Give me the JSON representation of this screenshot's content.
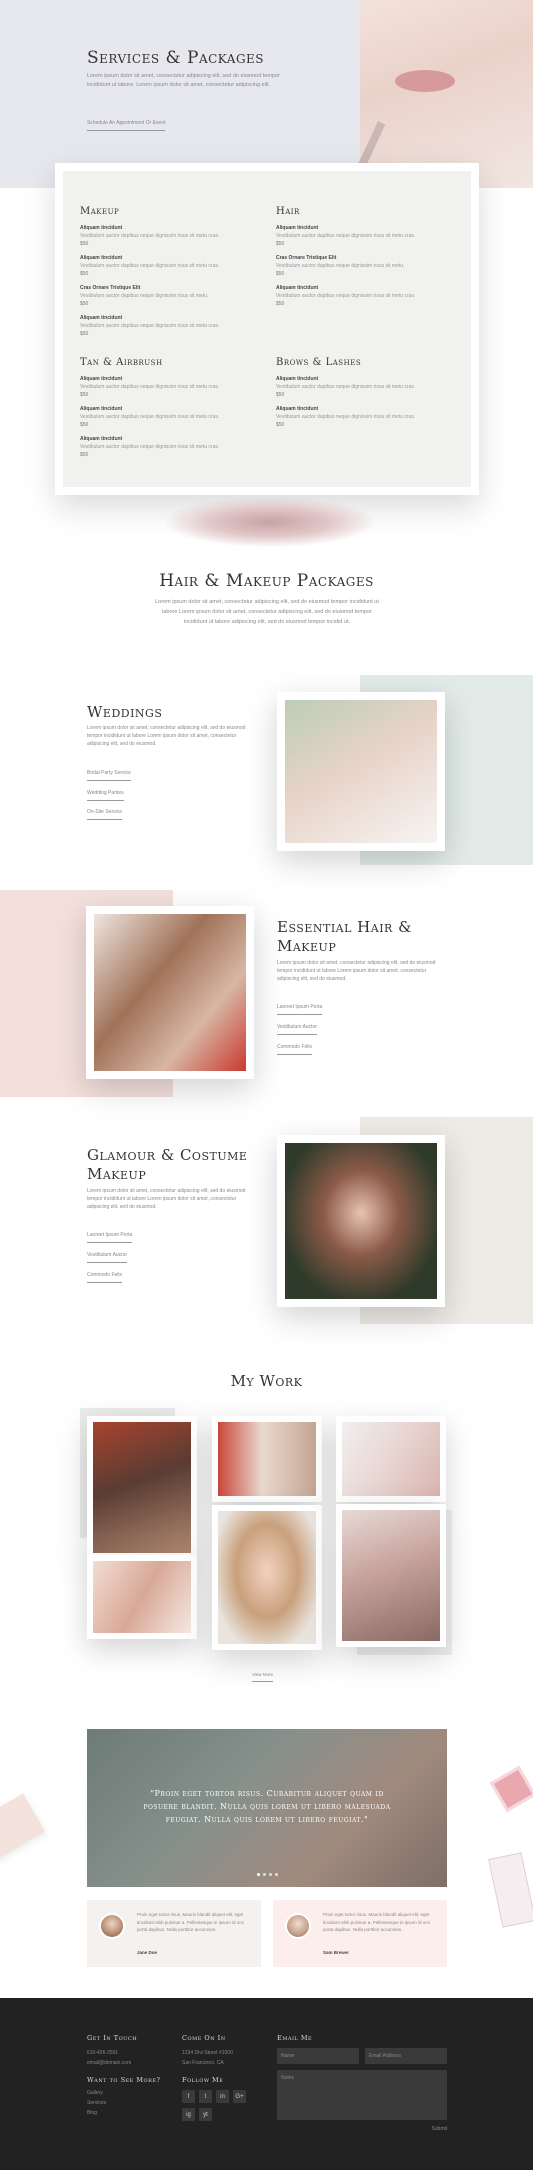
{
  "hero": {
    "title": "Services & Packages",
    "body": "Lorem ipsum dolor sit amet, consectetur adipiscing elit, sed do eiusmod tempor incididunt ut labore. Lorem ipsum dolor sit amet, consectetur adipiscing elit.",
    "cta": "Schedule An Appointment Or Event"
  },
  "services": {
    "makeup": {
      "heading": "Makeup",
      "items": [
        {
          "name": "Aliquam tincidunt",
          "desc": "Vestibulum auctor dapibus neque dignissim risus sit metu cras.",
          "price": "$50"
        },
        {
          "name": "Aliquam tincidunt",
          "desc": "Vestibulum auctor dapibus neque dignissim risus sit metu cras.",
          "price": "$50"
        },
        {
          "name": "Cras Ornare Tristique Elit",
          "desc": "Vestibulum auctor dapibus neque dignissim risus sit metu.",
          "price": "$50"
        },
        {
          "name": "Aliquam tincidunt",
          "desc": "Vestibulum auctor dapibus neque dignissim risus sit metu cras.",
          "price": "$50"
        }
      ]
    },
    "hair": {
      "heading": "Hair",
      "items": [
        {
          "name": "Aliquam tincidunt",
          "desc": "Vestibulum auctor dapibus neque dignissim risus sit metu cras.",
          "price": "$50"
        },
        {
          "name": "Cras Ornare Tristique Elit",
          "desc": "Vestibulum auctor dapibus neque dignissim risus sit metu.",
          "price": "$50"
        },
        {
          "name": "Aliquam tincidunt",
          "desc": "Vestibulum auctor dapibus neque dignissim risus sit metu cras.",
          "price": "$50"
        }
      ]
    },
    "tan": {
      "heading": "Tan & Airbrush",
      "items": [
        {
          "name": "Aliquam tincidunt",
          "desc": "Vestibulum auctor dapibus neque dignissim risus sit metu cras.",
          "price": "$50"
        },
        {
          "name": "Aliquam tincidunt",
          "desc": "Vestibulum auctor dapibus neque dignissim risus sit metu cras.",
          "price": "$50"
        },
        {
          "name": "Aliquam tincidunt",
          "desc": "Vestibulum auctor dapibus neque dignissim risus sit metu cras.",
          "price": "$50"
        }
      ]
    },
    "brows": {
      "heading": "Brows & Lashes",
      "items": [
        {
          "name": "Aliquam tincidunt",
          "desc": "Vestibulum auctor dapibus neque dignissim risus sit metu cras.",
          "price": "$50"
        },
        {
          "name": "Aliquam tincidunt",
          "desc": "Vestibulum auctor dapibus neque dignissim risus sit metu cras.",
          "price": "$50"
        }
      ]
    }
  },
  "packages": {
    "title": "Hair & Makeup Packages",
    "body": "Lorem ipsum dolor sit amet, consectetur adipiscing elit, sed do eiusmod tempor incididunt ut labore Lorem ipsum dolor sit amet, consectetur adipiscing elit, sed do eiusmod tempor incididunt ut labore adipiscing elit, sed do eiusmod tempor incidid ut."
  },
  "weddings": {
    "title": "Weddings",
    "body": "Lorem ipsum dolor sit amet, consectetur adipiscing elit, sed do eiusmod tempor incididunt ut labore Lorem ipsum dolor sit amet, consectetur adipiscing elit, sed do eiusmod.",
    "links": [
      "Bridal Party Service",
      "Wedding Parties",
      "On-Site Service"
    ]
  },
  "essential": {
    "title": "Essential Hair & Makeup",
    "body": "Lorem ipsum dolor sit amet, consectetur adipiscing elit, sed do eiusmod tempor incididunt ut labore Lorem ipsum dolor sit amet, consectetur adipiscing elit, sed do eiusmod.",
    "links": [
      "Laoreet Ipsum Porta",
      "Vestibulum Auctor",
      "Commodo Felis"
    ]
  },
  "glamour": {
    "title": "Glamour & Costume Makeup",
    "body": "Lorem ipsum dolor sit amet, consectetur adipiscing elit, sed do eiusmod tempor incididunt ut labore Lorem ipsum dolor sit amet, consectetur adipiscing elit, sed do eiusmod.",
    "links": [
      "Laoreet Ipsum Porta",
      "Vestibulum Auctor",
      "Commodo Felis"
    ]
  },
  "work": {
    "title": "My Work",
    "button": "View More"
  },
  "testimonial": {
    "quote": "\"Proin eget tortor risus. Curabitur aliquet quam id posuere blandit. Nulla quis lorem ut libero malesuada feugiat. Nulla quis lorem ut libero feugiat.\"",
    "cards": [
      {
        "text": "Proin eget tortor risus. Mauris blandit aliquet elit, eget tincidunt nibh pulvinar a. Pellentesque in ipsum id orci porta dapibus. Nulla porttitor accumsan.",
        "name": "Jane Doe"
      },
      {
        "text": "Proin eget tortor risus. Mauris blandit aliquet elit, eget tincidunt nibh pulvinar a. Pellentesque in ipsum id orci porta dapibus. Nulla porttitor accumsan.",
        "name": "Sam Brewer"
      }
    ]
  },
  "footer": {
    "touch_heading": "Get In Touch",
    "phone": "610-426-2501",
    "email": "email@domain.com",
    "more_heading": "Want to See More?",
    "more_links": [
      "Gallery",
      "Services",
      "Blog"
    ],
    "come_heading": "Come On In",
    "address1": "1234 Divi Street #1000",
    "address2": "San Francisco, CA",
    "follow_heading": "Follow Me",
    "social": [
      "f",
      "t",
      "in",
      "G+",
      "ig",
      "yt"
    ],
    "email_heading": "Email Me",
    "name_placeholder": "Name",
    "email_placeholder": "Email Address",
    "notes_placeholder": "Notes",
    "submit": "Submit"
  },
  "colors": {
    "hero_bg": "#e7e7ee",
    "panel_bg": "#f1f1ef",
    "mint": "#e2ebe8",
    "pink": "#f3dfdc",
    "beige": "#eeebe6",
    "footer_bg": "#222222"
  }
}
